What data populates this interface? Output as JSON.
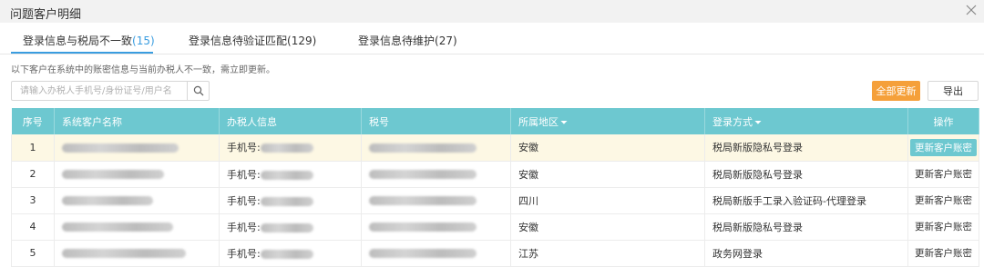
{
  "dialog": {
    "title": "问题客户明细"
  },
  "tabs": [
    {
      "label": "登录信息与税局不一致",
      "count": "(15)"
    },
    {
      "label": "登录信息待验证匹配",
      "count": "(129)"
    },
    {
      "label": "登录信息待维护",
      "count": "(27)"
    }
  ],
  "hint": "以下客户在系统中的账密信息与当前办税人不一致，需立即更新。",
  "search": {
    "placeholder": "请输入办税人手机号/身份证号/用户名"
  },
  "buttons": {
    "update_all": "全部更新",
    "export": "导出"
  },
  "table": {
    "headers": [
      "序号",
      "系统客户名称",
      "办税人信息",
      "税号",
      "所属地区",
      "登录方式",
      "操作"
    ],
    "rows": [
      {
        "no": "1",
        "phone": "手机号:",
        "region": "安徽",
        "login": "税局新版隐私号登录",
        "op": "更新客户账密"
      },
      {
        "no": "2",
        "phone": "手机号:",
        "region": "安徽",
        "login": "税局新版隐私号登录",
        "op": "更新客户账密"
      },
      {
        "no": "3",
        "phone": "手机号:",
        "region": "四川",
        "login": "税局新版手工录入验证码-代理登录",
        "op": "更新客户账密"
      },
      {
        "no": "4",
        "phone": "手机号:",
        "region": "安徽",
        "login": "税局新版隐私号登录",
        "op": "更新客户账密"
      },
      {
        "no": "5",
        "phone": "手机号:",
        "region": "江苏",
        "login": "政务网登录",
        "op": "更新客户账密"
      }
    ]
  },
  "colors": {
    "accent": "#3a9de0",
    "header_bg": "#6dc8d0",
    "orange": "#f5a03a",
    "highlight_row": "#fdf8e4"
  },
  "icons": {
    "close": "close-icon",
    "search": "search-icon",
    "filter": "filter-icon"
  }
}
